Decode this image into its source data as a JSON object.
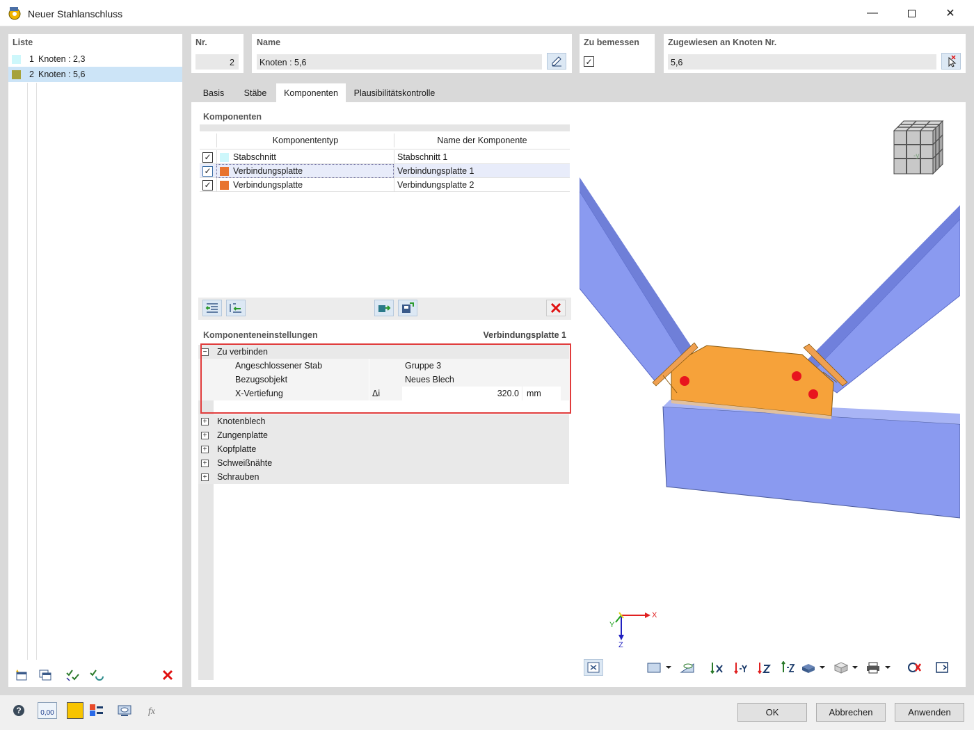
{
  "window": {
    "title": "Neuer Stahlanschluss"
  },
  "list": {
    "header": "Liste",
    "items": [
      {
        "nr": "1",
        "label": "Knoten : 2,3",
        "color": "#cdf7fb"
      },
      {
        "nr": "2",
        "label": "Knoten : 5,6",
        "color": "#a6a23a"
      }
    ]
  },
  "fields": {
    "nr_label": "Nr.",
    "nr_value": "2",
    "name_label": "Name",
    "name_value": "Knoten : 5,6",
    "design_label": "Zu bemessen",
    "design_checked": "✓",
    "assigned_label": "Zugewiesen an Knoten Nr.",
    "assigned_value": "5,6"
  },
  "tabs": [
    "Basis",
    "Stäbe",
    "Komponenten",
    "Plausibilitätskontrolle"
  ],
  "components": {
    "header": "Komponenten",
    "col_type": "Komponententyp",
    "col_name": "Name der Komponente",
    "rows": [
      {
        "check": "✓",
        "type": "Stabschnitt",
        "name": "Stabschnitt 1",
        "color": "#cdf7fb"
      },
      {
        "check": "✓",
        "type": "Verbindungsplatte",
        "name": "Verbindungsplatte 1",
        "color": "#e8742e"
      },
      {
        "check": "✓",
        "type": "Verbindungsplatte",
        "name": "Verbindungsplatte 2",
        "color": "#e8742e"
      }
    ]
  },
  "settings": {
    "header": "Komponenteneinstellungen",
    "current": "Verbindungsplatte 1",
    "group_open": {
      "toggle": "−",
      "label": "Zu verbinden"
    },
    "props": [
      {
        "label": "Angeschlossener Stab",
        "sym": "",
        "value": "Gruppe 3",
        "unit": ""
      },
      {
        "label": "Bezugsobjekt",
        "sym": "",
        "value": "Neues Blech",
        "unit": ""
      },
      {
        "label": "X-Vertiefung",
        "sym": "Δi",
        "value": "320.0",
        "unit": "mm"
      }
    ],
    "groups_closed": [
      {
        "toggle": "+",
        "label": "Knotenblech"
      },
      {
        "toggle": "+",
        "label": "Zungenplatte"
      },
      {
        "toggle": "+",
        "label": "Kopfplatte"
      },
      {
        "toggle": "+",
        "label": "Schweißnähte"
      },
      {
        "toggle": "+",
        "label": "Schrauben"
      }
    ]
  },
  "view3d": {
    "axis_x": "X",
    "axis_y": "Y",
    "axis_z": "Z",
    "cube_face": "-y",
    "member_color": "#8a9af0",
    "plate_color": "#f6a23a",
    "bolt_color": "#e8141e"
  },
  "buttons": {
    "ok": "OK",
    "cancel": "Abbrechen",
    "apply": "Anwenden"
  },
  "footer": {
    "value_icon_text": "0,00"
  }
}
